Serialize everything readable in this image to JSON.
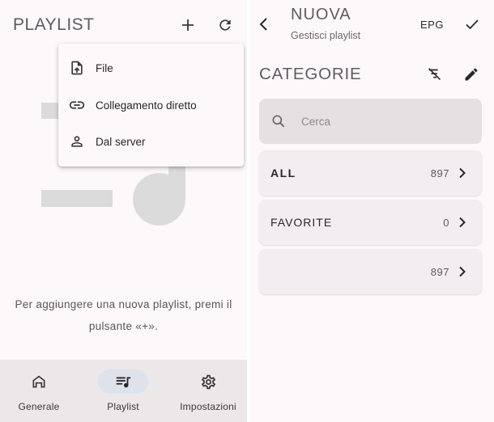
{
  "left": {
    "title": "PLAYLIST",
    "header_icons": [
      "plus-icon",
      "refresh-icon"
    ],
    "menu": {
      "items": [
        {
          "label": "File",
          "icon": "file-upload-icon"
        },
        {
          "label": "Collegamento diretto",
          "icon": "link-icon"
        },
        {
          "label": "Dal server",
          "icon": "person-icon"
        }
      ]
    },
    "empty_message_line1": "Per aggiungere una nuova playlist, premi il",
    "empty_message_line2": "pulsante «+».",
    "nav": {
      "items": [
        {
          "label": "Generale",
          "icon": "home-icon",
          "active": false
        },
        {
          "label": "Playlist",
          "icon": "playlist-music-icon",
          "active": true
        },
        {
          "label": "Impostazioni",
          "icon": "settings-icon",
          "active": false
        }
      ]
    }
  },
  "right": {
    "title": "NUOVA",
    "subtitle": "Gestisci playlist",
    "epg_label": "EPG",
    "section_title": "CATEGORIE",
    "search": {
      "placeholder": "Cerca",
      "value": ""
    },
    "categories": [
      {
        "name": "ALL",
        "count": "897",
        "bold": true
      },
      {
        "name": "FAVORITE",
        "count": "0",
        "bold": false
      },
      {
        "name": "",
        "count": "897",
        "bold": false
      }
    ]
  },
  "colors": {
    "background": "#fdf8fa",
    "nav_background": "#ece8ea",
    "nav_active_pill": "#dde2eb",
    "search_background": "#e5e1e3",
    "card_background": "#f1edf0",
    "placeholder_shape": "#dcdbdc"
  }
}
